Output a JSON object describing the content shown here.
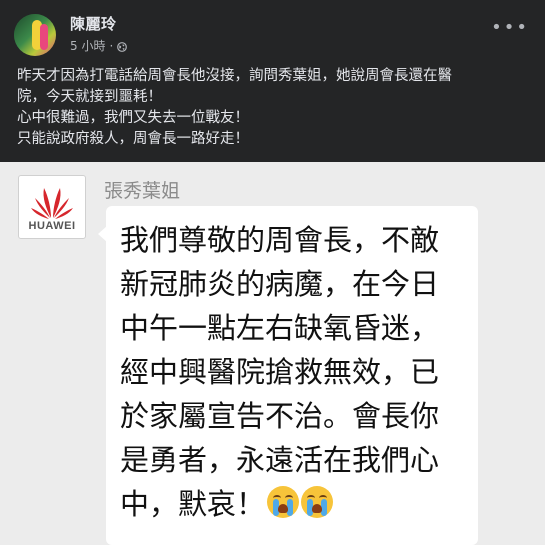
{
  "header": {
    "author": "陳麗玲",
    "time": "5 小時",
    "separator": "·",
    "privacy_icon": "globe-icon",
    "more_icon": "more-options-icon",
    "more_label": "•••"
  },
  "post": {
    "lines": [
      "昨天才因為打電話給周會長他沒接，詢問秀葉姐，她說周會長還在醫",
      "院，今天就接到噩耗！",
      "心中很難過，我們又失去一位戰友！",
      "只能說政府殺人，周會長一路好走！"
    ]
  },
  "image": {
    "logo_text": "HUAWEI",
    "sender": "張秀葉姐",
    "message_lines": [
      "我們尊敬的周會長，不敵",
      "新冠肺炎的病魔，在今日",
      "中午一點左右缺氧昏迷，",
      "經中興醫院搶救無效，已",
      "於家屬宣告不治。會長你",
      "是勇者，永遠活在我們心",
      "中，默哀！"
    ],
    "emoji": "crying-face-icon"
  },
  "colors": {
    "background": "#242526",
    "text": "#e4e6eb",
    "muted": "#b0b3b8",
    "logo_red": "#d6262c"
  }
}
